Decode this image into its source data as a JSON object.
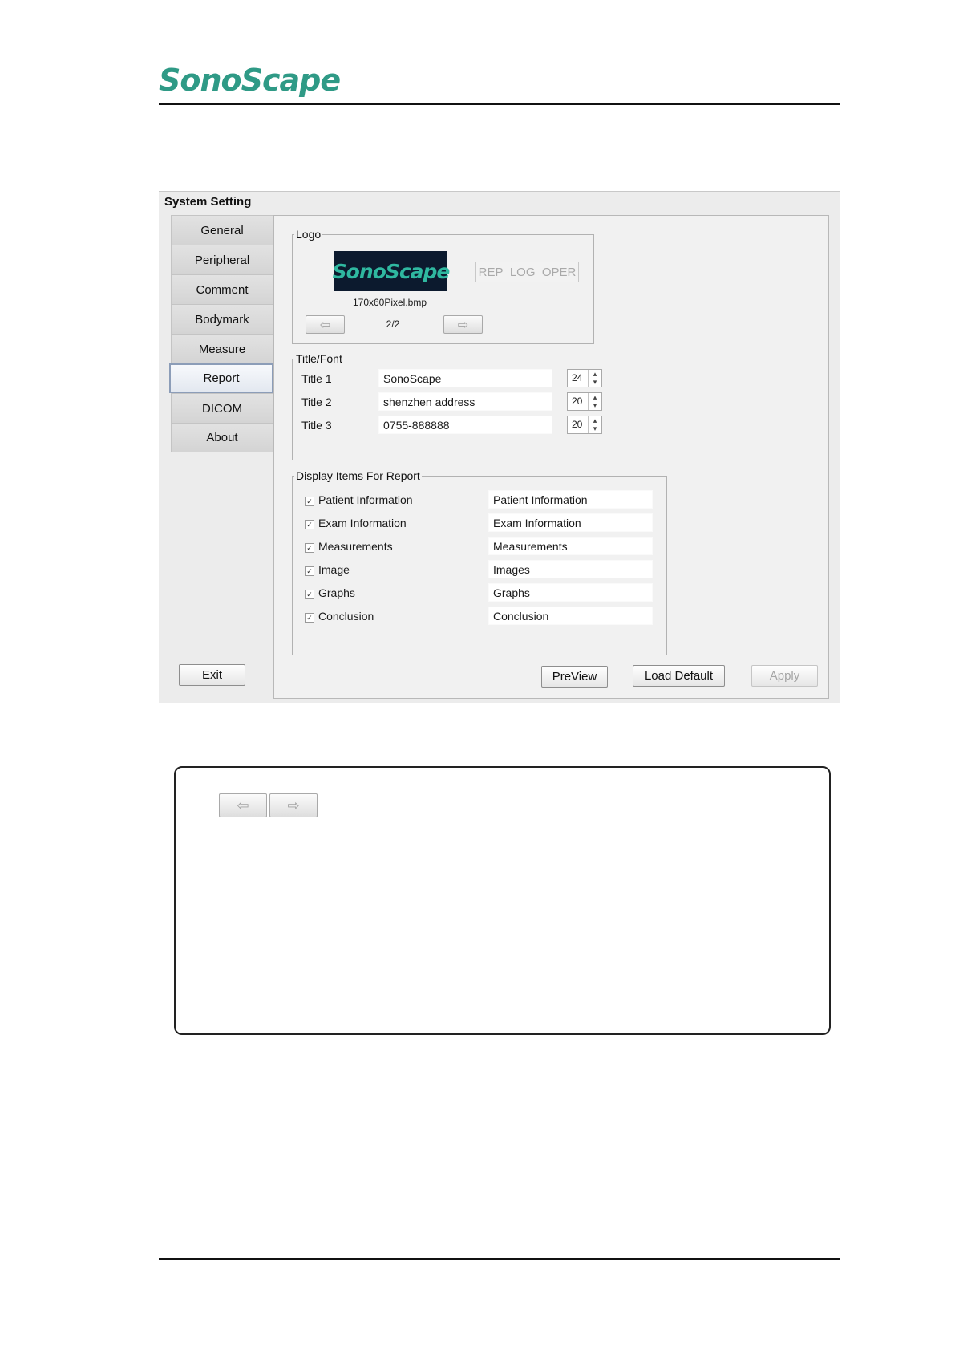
{
  "page": {
    "brand": "SonoScape"
  },
  "dialog": {
    "title": "System Setting",
    "tabs": [
      "General",
      "Peripheral",
      "Comment",
      "Bodymark",
      "Measure",
      "Report",
      "DICOM",
      "About"
    ],
    "active_tab": "Report",
    "logo": {
      "label": "Logo",
      "image_text": "SonoScape",
      "file_name": "170x60Pixel.bmp",
      "button_label": "REP_LOG_OPER",
      "page_indicator": "2/2",
      "prev_icon": "arrow-left-icon",
      "next_icon": "arrow-right-icon"
    },
    "title_font": {
      "label": "Title/Font",
      "rows": [
        {
          "label": "Title 1",
          "value": "SonoScape",
          "font_size": "24"
        },
        {
          "label": "Title 2",
          "value": "shenzhen address",
          "font_size": "20"
        },
        {
          "label": "Title 3",
          "value": "0755-888888",
          "font_size": "20"
        }
      ]
    },
    "display_items": {
      "label": "Display Items For Report",
      "items": [
        {
          "label": "Patient Information",
          "value": "Patient Information",
          "checked": true
        },
        {
          "label": "Exam Information",
          "value": "Exam Information",
          "checked": true
        },
        {
          "label": "Measurements",
          "value": "Measurements",
          "checked": true
        },
        {
          "label": "Image",
          "value": "Images",
          "checked": true
        },
        {
          "label": "Graphs",
          "value": "Graphs",
          "checked": true
        },
        {
          "label": "Conclusion",
          "value": "Conclusion",
          "checked": true
        }
      ]
    },
    "buttons": {
      "exit": "Exit",
      "preview": "PreView",
      "load_default": "Load Default",
      "apply": "Apply"
    }
  },
  "note": {
    "icons": [
      "arrow-left-icon",
      "arrow-right-icon"
    ]
  }
}
